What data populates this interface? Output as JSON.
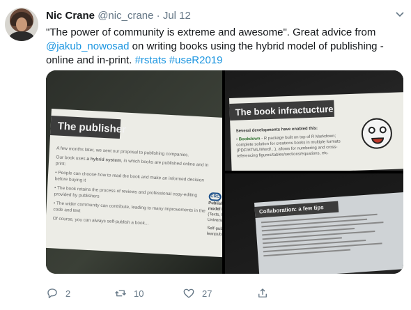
{
  "tweet": {
    "author_name": "Nic Crane",
    "handle": "@nic_crane",
    "separator": " · ",
    "date": "Jul 12",
    "text_part1": "\"The power of community is extreme and awesome\". Great advice from ",
    "mention": "@jakub_nowosad",
    "text_part2": " on writing books using the hybrid model of publishing - online and in-print. ",
    "hashtag1": "#rstats",
    "hashtag2": "#useR2019"
  },
  "photos": {
    "p1": {
      "title": "The publisher",
      "para1": "A few months later, we sent our proposal to publishing companies.",
      "para2a": "Our book uses ",
      "para2b": "a hybrid system",
      "para2c": ", in which books are published online and in print:",
      "bullet1": "People can choose how to read the book and make an informed decision before buying it",
      "bullet2": "The book retains the process of reviews and professional copy-editing provided by publishers",
      "bullet3": "The wider community can contribute, leading to many improvements in the code and text",
      "para3": "Of course, you can always self-publish a book...",
      "badge": "CRC",
      "side1": "Publishers",
      "side2": "model boo",
      "side3": "(Texts, Pr",
      "side4": "University",
      "side5": "Self-publi",
      "side6": "leanpub.c"
    },
    "p2": {
      "title": "The book infractucture",
      "lead": "Several developments have enabled this:",
      "keyword": "Bookdown",
      "body": " - R package built on top of R Markdown; complete solution for creations books in multiple formats (PDF/HTML/Word/...), allows for numbering and cross-referencing figures/tables/sections/equations, etc."
    },
    "p3": {
      "title": "Collaboration: a few tips"
    }
  },
  "actions": {
    "reply_count": "2",
    "retweet_count": "10",
    "like_count": "27"
  },
  "colors": {
    "link": "#1b95e0",
    "text": "#14171a",
    "muted": "#657786"
  }
}
